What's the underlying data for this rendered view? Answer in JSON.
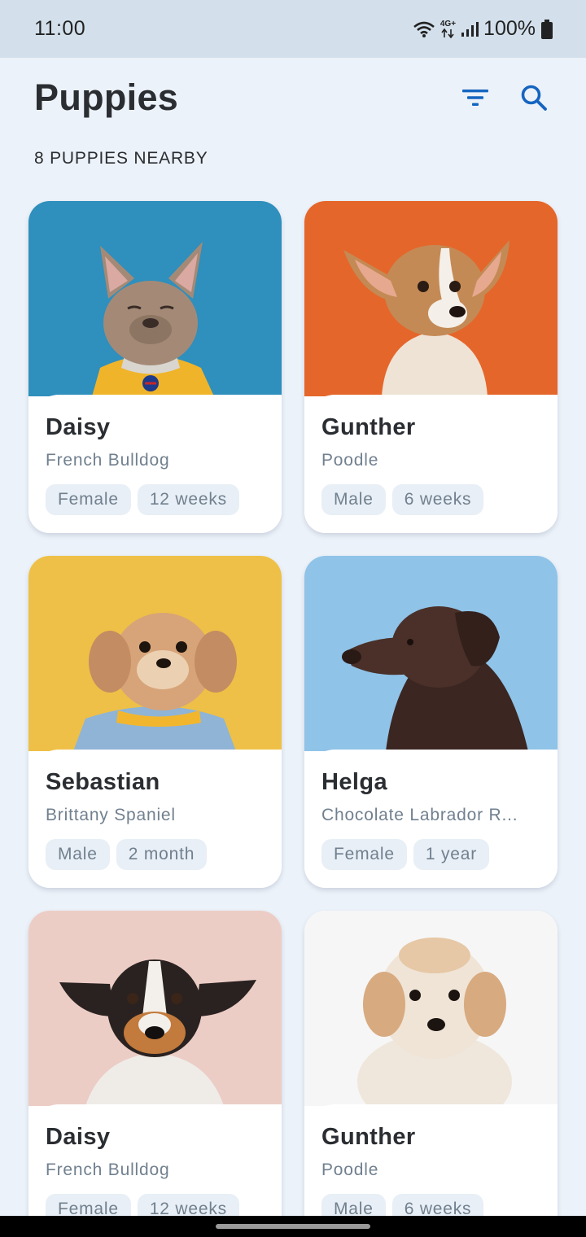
{
  "status_bar": {
    "time": "11:00",
    "network": "4G+",
    "battery": "100%",
    "icons": [
      "wifi-icon",
      "network-4g-icon",
      "signal-icon",
      "battery-icon"
    ]
  },
  "header": {
    "title": "Puppies",
    "actions": [
      "filter-icon",
      "search-icon"
    ]
  },
  "subtitle": "8 PUPPIES NEARBY",
  "theme": {
    "accent": "#1565c0",
    "background": "#ecf2f9",
    "chip_background": "#e8eff6",
    "secondary_text": "#71808f"
  },
  "puppies": [
    {
      "name": "Daisy",
      "breed": "French Bulldog",
      "sex": "Female",
      "age": "12 weeks"
    },
    {
      "name": "Gunther",
      "breed": "Poodle",
      "sex": "Male",
      "age": "6 weeks"
    },
    {
      "name": "Sebastian",
      "breed": "Brittany Spaniel",
      "sex": "Male",
      "age": "2 month"
    },
    {
      "name": "Helga",
      "breed": "Chocolate Labrador R...",
      "sex": "Female",
      "age": "1 year"
    },
    {
      "name": "Daisy",
      "breed": "French Bulldog",
      "sex": "Female",
      "age": "12 weeks"
    },
    {
      "name": "Gunther",
      "breed": "Poodle",
      "sex": "Male",
      "age": "6 weeks"
    }
  ]
}
